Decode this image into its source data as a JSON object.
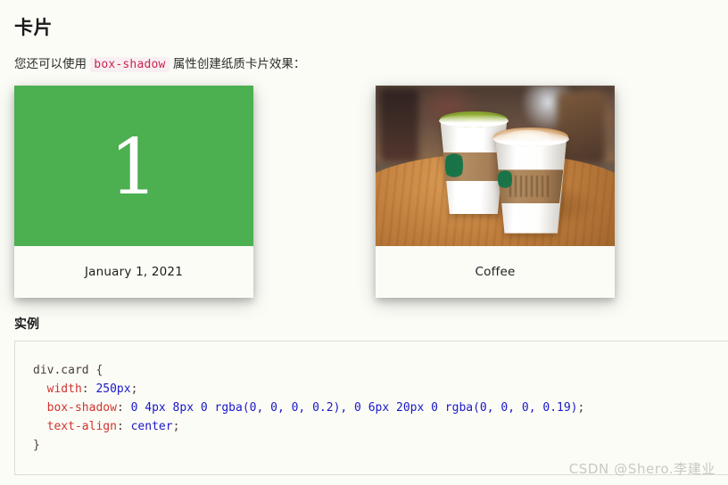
{
  "page": {
    "background_color": "#fcfcf7",
    "heading": "卡片",
    "intro_before": "您还可以使用 ",
    "intro_code": "box-shadow",
    "intro_after": " 属性创建纸质卡片效果：",
    "example_heading": "实例",
    "watermark": "CSDN @Shero.李建业"
  },
  "cards": [
    {
      "name": "date-card",
      "media_type": "color-block",
      "media_color": "#4caf50",
      "media_text": "1",
      "caption": "January 1, 2021"
    },
    {
      "name": "coffee-card",
      "media_type": "photo",
      "photo_description": "two starbucks paper cups of matcha latte and cappuccino on a wooden table",
      "caption": "Coffee"
    }
  ],
  "code": {
    "language": "css",
    "lines": [
      [
        {
          "t": "div.card {",
          "k": "sel"
        }
      ],
      [
        {
          "t": "  ",
          "k": "punc"
        },
        {
          "t": "width",
          "k": "prop"
        },
        {
          "t": ": ",
          "k": "punc"
        },
        {
          "t": "250px",
          "k": "val"
        },
        {
          "t": ";",
          "k": "punc"
        }
      ],
      [
        {
          "t": "  ",
          "k": "punc"
        },
        {
          "t": "box-shadow",
          "k": "prop"
        },
        {
          "t": ": ",
          "k": "punc"
        },
        {
          "t": "0 4px 8px 0 rgba(0, 0, 0, 0.2), 0 6px 20px 0 rgba(0, 0, 0, 0.19)",
          "k": "val"
        },
        {
          "t": ";",
          "k": "punc"
        }
      ],
      [
        {
          "t": "  ",
          "k": "punc"
        },
        {
          "t": "text-align",
          "k": "prop"
        },
        {
          "t": ": ",
          "k": "punc"
        },
        {
          "t": "center",
          "k": "val"
        },
        {
          "t": ";",
          "k": "punc"
        }
      ],
      [
        {
          "t": "}",
          "k": "sel"
        }
      ]
    ]
  },
  "colors": {
    "card_green": "#4caf50",
    "inline_code_text": "#c7254e",
    "inline_code_bg": "#f9eff2",
    "code_prop": "#d1332e",
    "code_val": "#1a18c8",
    "watermark": "#c9c9c4"
  }
}
